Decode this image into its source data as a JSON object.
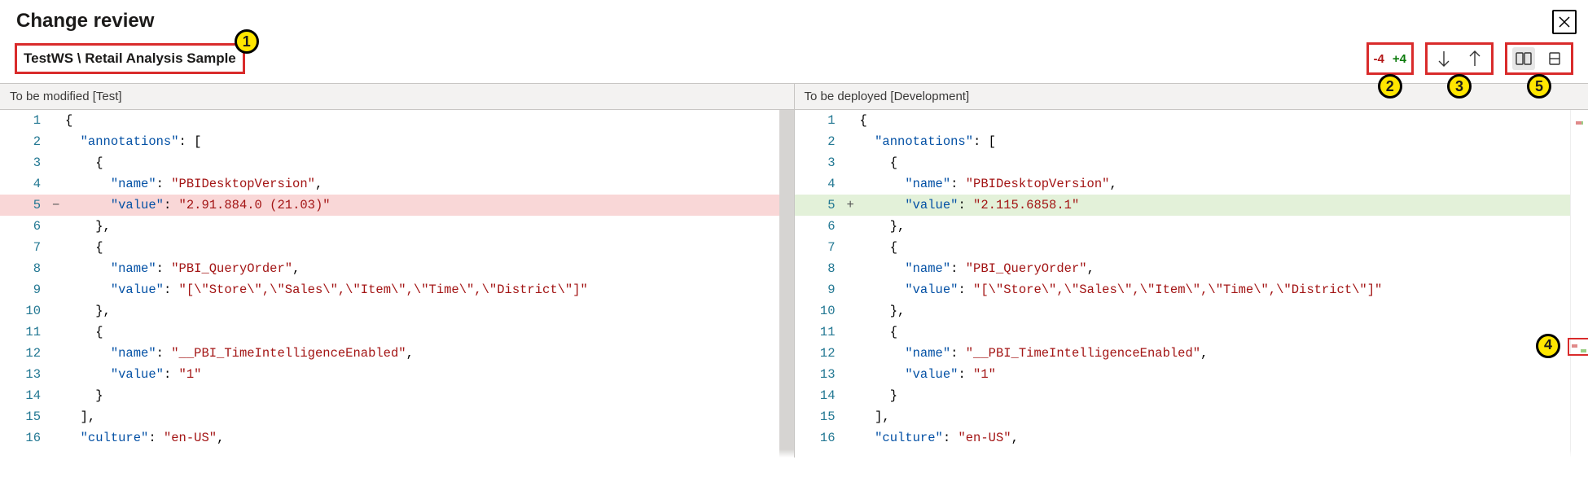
{
  "header": {
    "title": "Change review"
  },
  "breadcrumb": {
    "workspace": "TestWS",
    "sep": " \\ ",
    "item": "Retail Analysis Sample"
  },
  "toolbar": {
    "removed_label": "-4",
    "added_label": "+4"
  },
  "callouts": {
    "c1": "1",
    "c2": "2",
    "c3": "3",
    "c4": "4",
    "c5": "5"
  },
  "left_pane": {
    "title": "To be modified [Test]",
    "lines": [
      {
        "n": "1",
        "mark": "",
        "cls": "",
        "tokens": [
          [
            "pun",
            "{"
          ]
        ]
      },
      {
        "n": "2",
        "mark": "",
        "cls": "",
        "tokens": [
          [
            "pun",
            "  "
          ],
          [
            "key",
            "\"annotations\""
          ],
          [
            "pun",
            ": ["
          ]
        ]
      },
      {
        "n": "3",
        "mark": "",
        "cls": "",
        "tokens": [
          [
            "pun",
            "    {"
          ]
        ]
      },
      {
        "n": "4",
        "mark": "",
        "cls": "",
        "tokens": [
          [
            "pun",
            "      "
          ],
          [
            "key",
            "\"name\""
          ],
          [
            "pun",
            ": "
          ],
          [
            "str",
            "\"PBIDesktopVersion\""
          ],
          [
            "pun",
            ","
          ]
        ]
      },
      {
        "n": "5",
        "mark": "−",
        "cls": "l-rem",
        "tokens": [
          [
            "pun",
            "      "
          ],
          [
            "key",
            "\"value\""
          ],
          [
            "pun",
            ": "
          ],
          [
            "str",
            "\"2.91.884.0 (21.03)\""
          ]
        ]
      },
      {
        "n": "6",
        "mark": "",
        "cls": "",
        "tokens": [
          [
            "pun",
            "    },"
          ]
        ]
      },
      {
        "n": "7",
        "mark": "",
        "cls": "",
        "tokens": [
          [
            "pun",
            "    {"
          ]
        ]
      },
      {
        "n": "8",
        "mark": "",
        "cls": "",
        "tokens": [
          [
            "pun",
            "      "
          ],
          [
            "key",
            "\"name\""
          ],
          [
            "pun",
            ": "
          ],
          [
            "str",
            "\"PBI_QueryOrder\""
          ],
          [
            "pun",
            ","
          ]
        ]
      },
      {
        "n": "9",
        "mark": "",
        "cls": "",
        "tokens": [
          [
            "pun",
            "      "
          ],
          [
            "key",
            "\"value\""
          ],
          [
            "pun",
            ": "
          ],
          [
            "str",
            "\"[\\\"Store\\\",\\\"Sales\\\",\\\"Item\\\",\\\"Time\\\",\\\"District\\\"]\""
          ]
        ]
      },
      {
        "n": "10",
        "mark": "",
        "cls": "",
        "tokens": [
          [
            "pun",
            "    },"
          ]
        ]
      },
      {
        "n": "11",
        "mark": "",
        "cls": "",
        "tokens": [
          [
            "pun",
            "    {"
          ]
        ]
      },
      {
        "n": "12",
        "mark": "",
        "cls": "",
        "tokens": [
          [
            "pun",
            "      "
          ],
          [
            "key",
            "\"name\""
          ],
          [
            "pun",
            ": "
          ],
          [
            "str",
            "\"__PBI_TimeIntelligenceEnabled\""
          ],
          [
            "pun",
            ","
          ]
        ]
      },
      {
        "n": "13",
        "mark": "",
        "cls": "",
        "tokens": [
          [
            "pun",
            "      "
          ],
          [
            "key",
            "\"value\""
          ],
          [
            "pun",
            ": "
          ],
          [
            "str",
            "\"1\""
          ]
        ]
      },
      {
        "n": "14",
        "mark": "",
        "cls": "",
        "tokens": [
          [
            "pun",
            "    }"
          ]
        ]
      },
      {
        "n": "15",
        "mark": "",
        "cls": "",
        "tokens": [
          [
            "pun",
            "  ],"
          ]
        ]
      },
      {
        "n": "16",
        "mark": "",
        "cls": "",
        "tokens": [
          [
            "pun",
            "  "
          ],
          [
            "key",
            "\"culture\""
          ],
          [
            "pun",
            ": "
          ],
          [
            "str",
            "\"en-US\""
          ],
          [
            "pun",
            ","
          ]
        ]
      }
    ]
  },
  "right_pane": {
    "title": "To be deployed [Development]",
    "lines": [
      {
        "n": "1",
        "mark": "",
        "cls": "",
        "tokens": [
          [
            "pun",
            "{"
          ]
        ]
      },
      {
        "n": "2",
        "mark": "",
        "cls": "",
        "tokens": [
          [
            "pun",
            "  "
          ],
          [
            "key",
            "\"annotations\""
          ],
          [
            "pun",
            ": ["
          ]
        ]
      },
      {
        "n": "3",
        "mark": "",
        "cls": "",
        "tokens": [
          [
            "pun",
            "    {"
          ]
        ]
      },
      {
        "n": "4",
        "mark": "",
        "cls": "",
        "tokens": [
          [
            "pun",
            "      "
          ],
          [
            "key",
            "\"name\""
          ],
          [
            "pun",
            ": "
          ],
          [
            "str",
            "\"PBIDesktopVersion\""
          ],
          [
            "pun",
            ","
          ]
        ]
      },
      {
        "n": "5",
        "mark": "+",
        "cls": "l-add",
        "tokens": [
          [
            "pun",
            "      "
          ],
          [
            "key",
            "\"value\""
          ],
          [
            "pun",
            ": "
          ],
          [
            "str",
            "\"2.115.6858.1\""
          ]
        ]
      },
      {
        "n": "6",
        "mark": "",
        "cls": "",
        "tokens": [
          [
            "pun",
            "    },"
          ]
        ]
      },
      {
        "n": "7",
        "mark": "",
        "cls": "",
        "tokens": [
          [
            "pun",
            "    {"
          ]
        ]
      },
      {
        "n": "8",
        "mark": "",
        "cls": "",
        "tokens": [
          [
            "pun",
            "      "
          ],
          [
            "key",
            "\"name\""
          ],
          [
            "pun",
            ": "
          ],
          [
            "str",
            "\"PBI_QueryOrder\""
          ],
          [
            "pun",
            ","
          ]
        ]
      },
      {
        "n": "9",
        "mark": "",
        "cls": "",
        "tokens": [
          [
            "pun",
            "      "
          ],
          [
            "key",
            "\"value\""
          ],
          [
            "pun",
            ": "
          ],
          [
            "str",
            "\"[\\\"Store\\\",\\\"Sales\\\",\\\"Item\\\",\\\"Time\\\",\\\"District\\\"]\""
          ]
        ]
      },
      {
        "n": "10",
        "mark": "",
        "cls": "",
        "tokens": [
          [
            "pun",
            "    },"
          ]
        ]
      },
      {
        "n": "11",
        "mark": "",
        "cls": "",
        "tokens": [
          [
            "pun",
            "    {"
          ]
        ]
      },
      {
        "n": "12",
        "mark": "",
        "cls": "",
        "tokens": [
          [
            "pun",
            "      "
          ],
          [
            "key",
            "\"name\""
          ],
          [
            "pun",
            ": "
          ],
          [
            "str",
            "\"__PBI_TimeIntelligenceEnabled\""
          ],
          [
            "pun",
            ","
          ]
        ]
      },
      {
        "n": "13",
        "mark": "",
        "cls": "",
        "tokens": [
          [
            "pun",
            "      "
          ],
          [
            "key",
            "\"value\""
          ],
          [
            "pun",
            ": "
          ],
          [
            "str",
            "\"1\""
          ]
        ]
      },
      {
        "n": "14",
        "mark": "",
        "cls": "",
        "tokens": [
          [
            "pun",
            "    }"
          ]
        ]
      },
      {
        "n": "15",
        "mark": "",
        "cls": "",
        "tokens": [
          [
            "pun",
            "  ],"
          ]
        ]
      },
      {
        "n": "16",
        "mark": "",
        "cls": "",
        "tokens": [
          [
            "pun",
            "  "
          ],
          [
            "key",
            "\"culture\""
          ],
          [
            "pun",
            ": "
          ],
          [
            "str",
            "\"en-US\""
          ],
          [
            "pun",
            ","
          ]
        ]
      }
    ]
  }
}
